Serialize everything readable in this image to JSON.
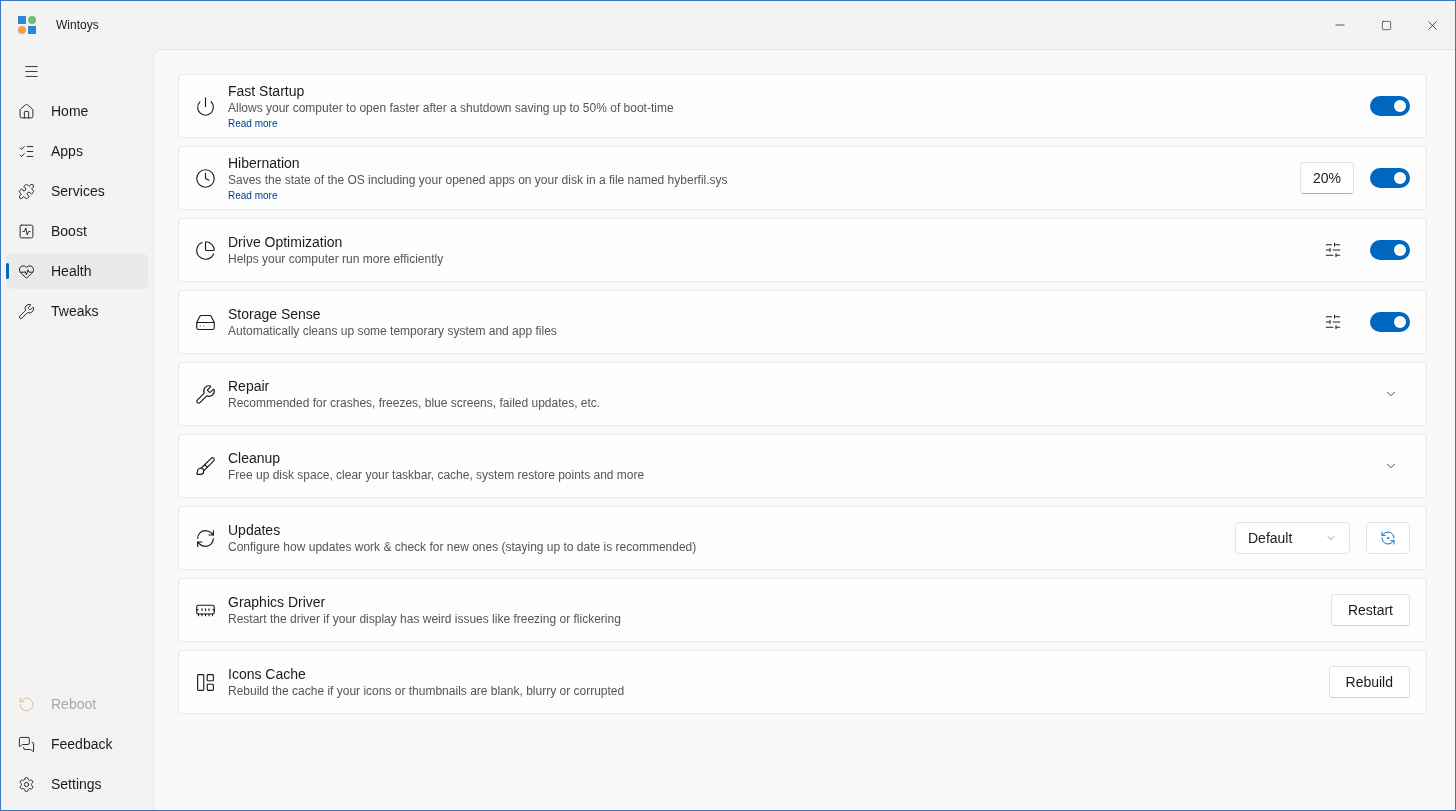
{
  "window": {
    "title": "Wintoys"
  },
  "sidebar": {
    "items": [
      {
        "label": "Home",
        "selected": false,
        "disabled": false
      },
      {
        "label": "Apps",
        "selected": false,
        "disabled": false
      },
      {
        "label": "Services",
        "selected": false,
        "disabled": false
      },
      {
        "label": "Boost",
        "selected": false,
        "disabled": false
      },
      {
        "label": "Health",
        "selected": true,
        "disabled": false
      },
      {
        "label": "Tweaks",
        "selected": false,
        "disabled": false
      }
    ],
    "footer_items": [
      {
        "label": "Reboot",
        "selected": false,
        "disabled": true
      },
      {
        "label": "Feedback",
        "selected": false,
        "disabled": false
      },
      {
        "label": "Settings",
        "selected": false,
        "disabled": false
      }
    ]
  },
  "settings": [
    {
      "title": "Fast Startup",
      "description": "Allows your computer to open faster after a shutdown saving up to 50% of boot-time",
      "link": "Read more",
      "controls": [
        {
          "kind": "toggle",
          "on": true
        }
      ]
    },
    {
      "title": "Hibernation",
      "description": "Saves the state of the OS including your opened apps on your disk in a file named hyberfil.sys",
      "link": "Read more",
      "controls": [
        {
          "kind": "value",
          "text": "20%"
        },
        {
          "kind": "toggle",
          "on": true
        }
      ]
    },
    {
      "title": "Drive Optimization",
      "description": "Helps your computer run more efficiently",
      "controls": [
        {
          "kind": "options"
        },
        {
          "kind": "toggle",
          "on": true
        }
      ]
    },
    {
      "title": "Storage Sense",
      "description": "Automatically cleans up some temporary system and app files",
      "controls": [
        {
          "kind": "options"
        },
        {
          "kind": "toggle",
          "on": true
        }
      ]
    },
    {
      "title": "Repair",
      "description": "Recommended for crashes, freezes, blue screens, failed updates, etc.",
      "controls": [
        {
          "kind": "expander",
          "expanded": false
        }
      ]
    },
    {
      "title": "Cleanup",
      "description": "Free up disk space, clear your taskbar, cache, system restore points and more",
      "controls": [
        {
          "kind": "expander",
          "expanded": false
        }
      ]
    },
    {
      "title": "Updates",
      "description": "Configure how updates work & check for new ones (staying up to date is recommended)",
      "controls": [
        {
          "kind": "dropdown",
          "value": "Default"
        },
        {
          "kind": "check"
        }
      ]
    },
    {
      "title": "Graphics Driver",
      "description": "Restart the driver if your display has weird issues like freezing or flickering",
      "controls": [
        {
          "kind": "button",
          "label": "Restart"
        }
      ]
    },
    {
      "title": "Icons Cache",
      "description": "Rebuild the cache if your icons or thumbnails are blank, blurry or corrupted",
      "controls": [
        {
          "kind": "button",
          "label": "Rebuild"
        }
      ]
    }
  ]
}
